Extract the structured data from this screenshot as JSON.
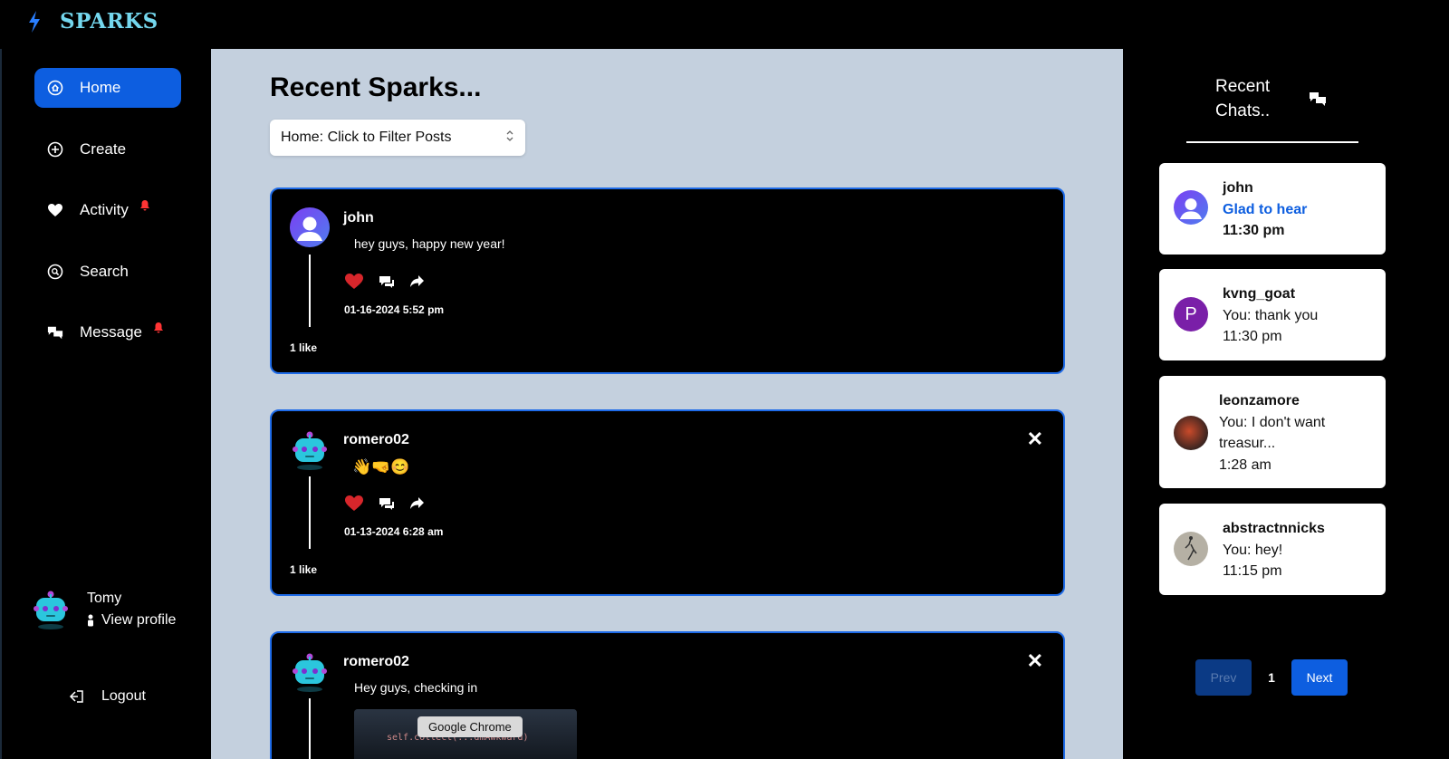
{
  "brand": {
    "name": "SPARKS",
    "icon": "bolt-icon"
  },
  "sidebar": {
    "items": [
      {
        "label": "Home",
        "icon": "home-icon",
        "active": true
      },
      {
        "label": "Create",
        "icon": "plus-circle-icon"
      },
      {
        "label": "Activity",
        "icon": "heart-icon",
        "notification": true
      },
      {
        "label": "Search",
        "icon": "search-icon"
      },
      {
        "label": "Message",
        "icon": "chat-bubbles-icon",
        "notification": true
      }
    ],
    "profile": {
      "name": "Tomy",
      "view_label": "View profile"
    },
    "logout_label": "Logout"
  },
  "main": {
    "title": "Recent Sparks...",
    "filter_value": "Home: Click to Filter Posts",
    "posts": [
      {
        "author": "john",
        "text": "hey guys, happy new year!",
        "date": "01-16-2024 5:52 pm",
        "likes": "1 like"
      },
      {
        "author": "romero02",
        "text": "👋🤜😊",
        "date": "01-13-2024 6:28 am",
        "likes": "1 like"
      },
      {
        "author": "romero02",
        "text": "Hey guys, checking in",
        "image_code": "self.collect(...dmAwkward)"
      }
    ],
    "tooltip": "Google Chrome"
  },
  "chats": {
    "title_line1": "Recent",
    "title_line2": "Chats..",
    "items": [
      {
        "name": "john",
        "message": "Glad to hear",
        "time": "11:30 pm",
        "unread": true
      },
      {
        "name": "kvng_goat",
        "message": "You: thank you",
        "time": "11:30 pm",
        "initial": "P"
      },
      {
        "name": "leonzamore",
        "message_line1": "You: I don't want",
        "message_line2": "treasur...",
        "time": "1:28 am"
      },
      {
        "name": "abstractnnicks",
        "message": "You: hey!",
        "time": "11:15 pm"
      }
    ],
    "pager": {
      "prev": "Prev",
      "page": "1",
      "next": "Next"
    }
  },
  "colors": {
    "accent": "#0d5ee0",
    "main_bg": "#c4d0de",
    "brand": "#74d7ee",
    "notification": "#ff3434"
  }
}
